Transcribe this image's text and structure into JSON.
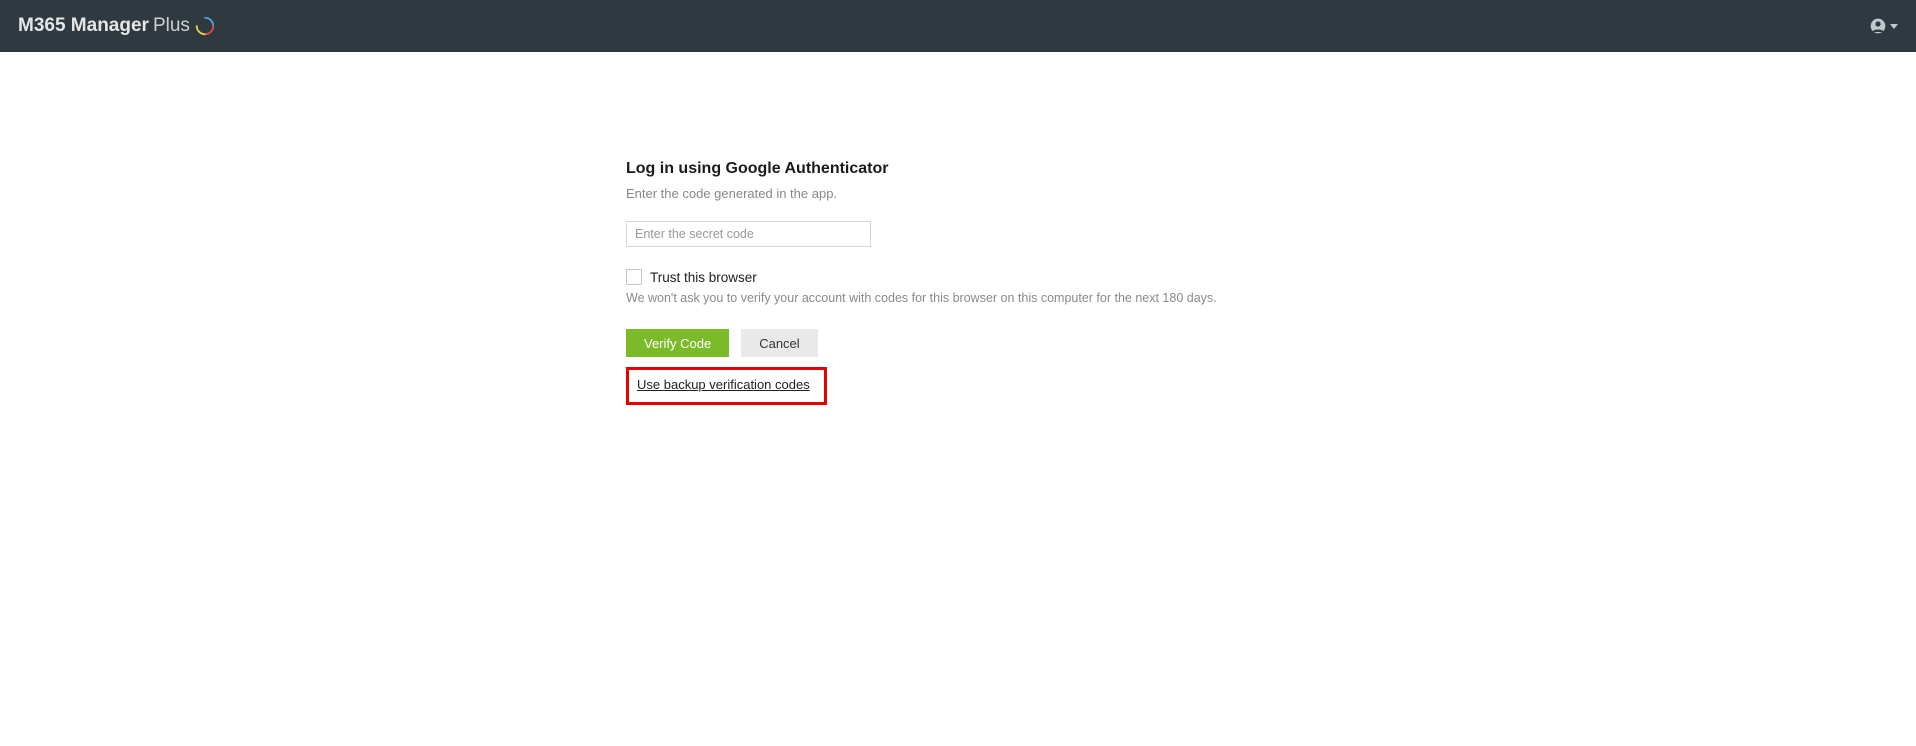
{
  "header": {
    "logo_prefix": "M365 Manager",
    "logo_suffix": "Plus"
  },
  "form": {
    "title": "Log in using Google Authenticator",
    "subtitle": "Enter the code generated in the app.",
    "code_placeholder": "Enter the secret code",
    "trust_label": "Trust this browser",
    "trust_note": "We won't ask you to verify your account with codes for this browser on this computer for the next 180 days.",
    "verify_btn": "Verify Code",
    "cancel_btn": "Cancel",
    "backup_link": "Use backup verification codes"
  }
}
